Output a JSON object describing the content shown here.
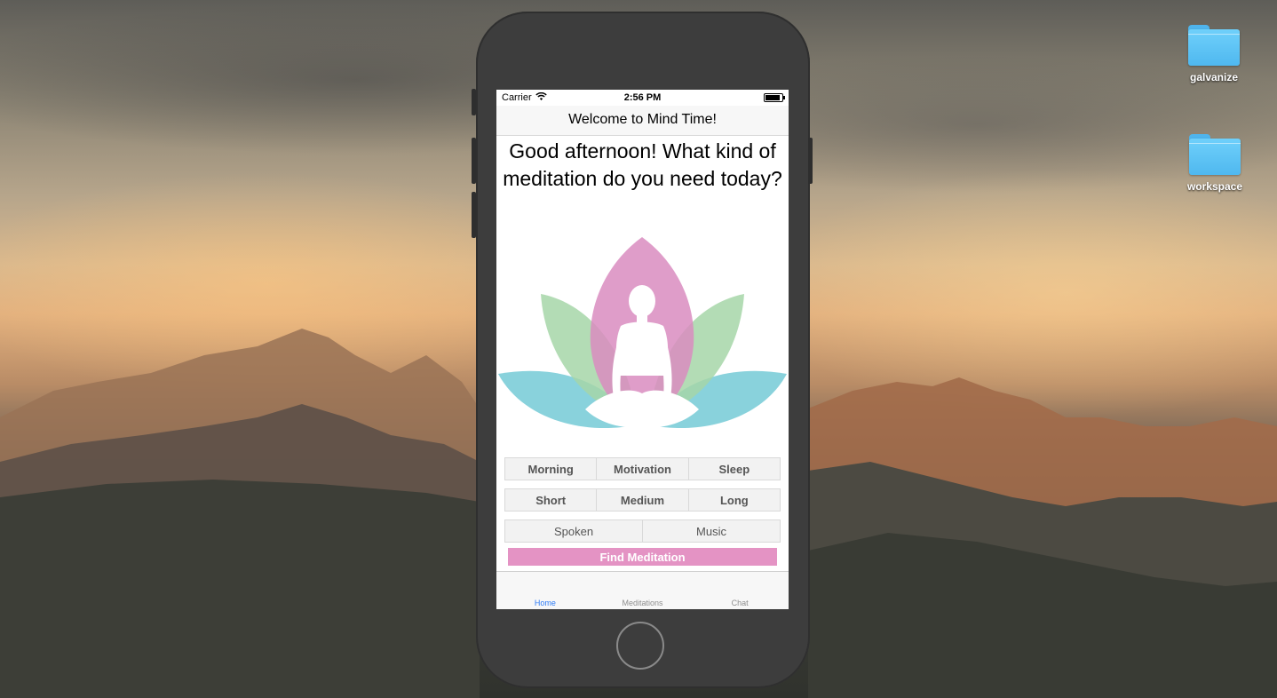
{
  "desktop": {
    "icons": [
      {
        "label": "galvanize",
        "icon": "folder-icon"
      },
      {
        "label": "workspace",
        "icon": "folder-icon"
      }
    ]
  },
  "status_bar": {
    "carrier": "Carrier",
    "wifi_icon": "wifi-icon",
    "time": "2:56 PM",
    "battery_icon": "battery-icon"
  },
  "nav": {
    "title": "Welcome to Mind Time!"
  },
  "main": {
    "headline": "Good afternoon! What kind of meditation do you need today?",
    "illustration": "lotus-meditation-icon",
    "time_of_day": [
      "Morning",
      "Motivation",
      "Sleep"
    ],
    "length": [
      "Short",
      "Medium",
      "Long"
    ],
    "type": [
      "Spoken",
      "Music"
    ],
    "find_button": "Find Meditation"
  },
  "tabbar": {
    "items": [
      {
        "label": "Home",
        "active": true
      },
      {
        "label": "Meditations",
        "active": false
      },
      {
        "label": "Chat",
        "active": false
      }
    ]
  },
  "colors": {
    "accent": "#e493c4",
    "tab_active": "#2f7cf6",
    "petal_pink": "#d98cc0",
    "petal_green": "#a6d6a8",
    "petal_teal": "#74cad6"
  }
}
